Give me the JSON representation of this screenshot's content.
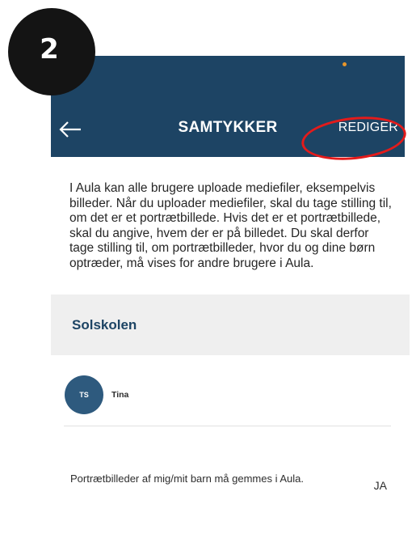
{
  "step_marker": "2",
  "header": {
    "title": "SAMTYKKER",
    "back_icon": "arrow-left-icon",
    "edit_label": "REDIGER",
    "background_color": "#1d4464",
    "status_dot_color": "#e8962a"
  },
  "annotation": {
    "highlight_color": "#e31b1b"
  },
  "intro": {
    "text": "I Aula kan alle brugere uploade mediefiler, eksempelvis billeder. Når du uploader mediefiler, skal du tage stilling til, om det er et portrætbillede. Hvis det er et portrætbillede, skal du angive, hvem der er på billedet. Du skal derfor tage stilling til, om portrætbilleder, hvor du og dine børn optræder, må vises for andre brugere i Aula."
  },
  "section": {
    "title": "Solskolen"
  },
  "user": {
    "initials": "TS",
    "name": "Tina"
  },
  "consent": {
    "label": "Portrætbilleder af mig/mit barn må gemmes i Aula.",
    "value": "JA"
  }
}
